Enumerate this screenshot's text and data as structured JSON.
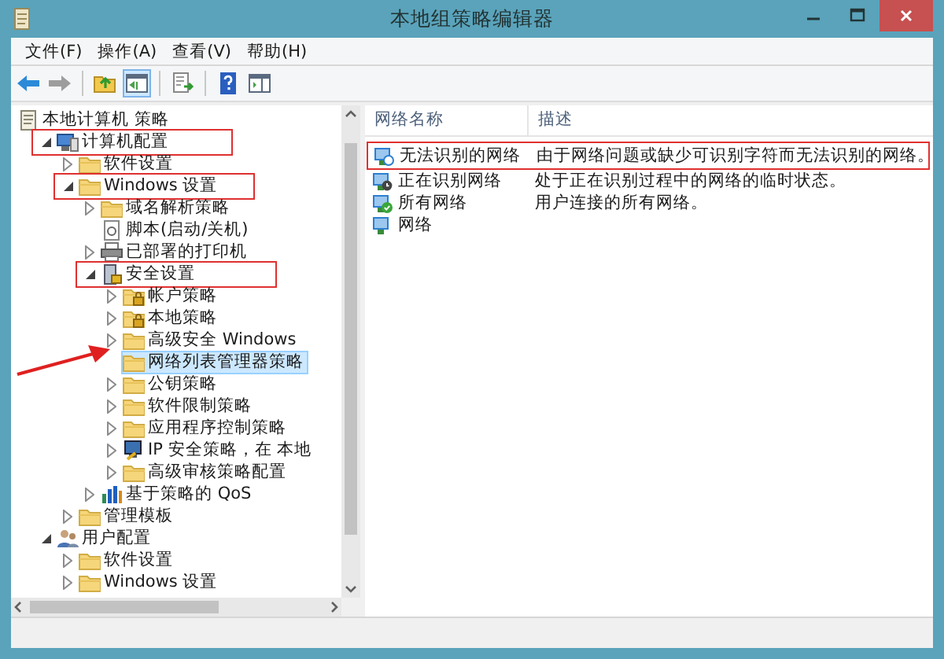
{
  "window": {
    "title": "本地组策略编辑器"
  },
  "menu": [
    "文件(F)",
    "操作(A)",
    "查看(V)",
    "帮助(H)"
  ],
  "toolbar": [
    [
      {
        "kind": "back",
        "pressed": false,
        "disabled": false
      },
      {
        "kind": "forward",
        "pressed": false,
        "disabled": true
      }
    ],
    [
      {
        "kind": "up",
        "pressed": false,
        "disabled": false
      },
      {
        "kind": "tree",
        "pressed": true,
        "disabled": false
      }
    ],
    [
      {
        "kind": "export",
        "pressed": false,
        "disabled": false
      }
    ],
    [
      {
        "kind": "help",
        "pressed": false,
        "disabled": false
      },
      {
        "kind": "pane",
        "pressed": false,
        "disabled": false
      }
    ]
  ],
  "tree": {
    "pointer_arrow": true,
    "items": [
      {
        "label": "本地计算机 策略",
        "kind": "policy",
        "selected": false,
        "annotated": false,
        "children": [
          {
            "label": "计算机配置",
            "kind": "computer",
            "expanded": true,
            "selected": false,
            "annotated": true,
            "children": [
              {
                "label": "软件设置",
                "kind": "folder",
                "expanded": false,
                "selected": false,
                "annotated": false
              },
              {
                "label": "Windows 设置",
                "kind": "folder",
                "expanded": true,
                "selected": false,
                "annotated": true,
                "children": [
                  {
                    "label": "域名解析策略",
                    "kind": "folder",
                    "expanded": false,
                    "selected": false,
                    "annotated": false
                  },
                  {
                    "label": "脚本(启动/关机)",
                    "kind": "script",
                    "selected": false,
                    "annotated": false
                  },
                  {
                    "label": "已部署的打印机",
                    "kind": "printer",
                    "expanded": false,
                    "selected": false,
                    "annotated": false
                  },
                  {
                    "label": "安全设置",
                    "kind": "security",
                    "expanded": true,
                    "selected": false,
                    "annotated": true,
                    "children": [
                      {
                        "label": "帐户策略",
                        "kind": "folder-lock",
                        "expanded": false,
                        "selected": false,
                        "annotated": false
                      },
                      {
                        "label": "本地策略",
                        "kind": "folder-lock",
                        "expanded": false,
                        "selected": false,
                        "annotated": false
                      },
                      {
                        "label": "高级安全 Windows",
                        "kind": "folder",
                        "expanded": false,
                        "selected": false,
                        "annotated": false
                      },
                      {
                        "label": "网络列表管理器策略",
                        "kind": "folder",
                        "selected": true,
                        "annotated": false
                      },
                      {
                        "label": "公钥策略",
                        "kind": "folder",
                        "expanded": false,
                        "selected": false,
                        "annotated": false
                      },
                      {
                        "label": "软件限制策略",
                        "kind": "folder",
                        "expanded": false,
                        "selected": false,
                        "annotated": false
                      },
                      {
                        "label": "应用程序控制策略",
                        "kind": "folder",
                        "expanded": false,
                        "selected": false,
                        "annotated": false
                      },
                      {
                        "label": "IP 安全策略，在 本地",
                        "kind": "ipsec",
                        "expanded": false,
                        "selected": false,
                        "annotated": false
                      },
                      {
                        "label": "高级审核策略配置",
                        "kind": "folder",
                        "expanded": false,
                        "selected": false,
                        "annotated": false
                      }
                    ]
                  },
                  {
                    "label": "基于策略的 QoS",
                    "kind": "qos",
                    "expanded": false,
                    "selected": false,
                    "annotated": false
                  }
                ]
              },
              {
                "label": "管理模板",
                "kind": "folder",
                "expanded": false,
                "selected": false,
                "annotated": false
              }
            ]
          },
          {
            "label": "用户配置",
            "kind": "user",
            "expanded": true,
            "selected": false,
            "annotated": false,
            "children": [
              {
                "label": "软件设置",
                "kind": "folder",
                "expanded": false,
                "selected": false,
                "annotated": false
              },
              {
                "label": "Windows 设置",
                "kind": "folder",
                "expanded": false,
                "selected": false,
                "annotated": false
              }
            ]
          }
        ]
      }
    ]
  },
  "list": {
    "columns": [
      "网络名称",
      "描述"
    ],
    "rows": [
      {
        "name": "无法识别的网络",
        "description": "由于网络问题或缺少可识别字符而无法识别的网络。",
        "kind": "unknown",
        "annotated": true
      },
      {
        "name": "正在识别网络",
        "description": "处于正在识别过程中的网络的临时状态。",
        "kind": "identifying",
        "annotated": false
      },
      {
        "name": "所有网络",
        "description": "用户连接的所有网络。",
        "kind": "all",
        "annotated": false
      },
      {
        "name": "网络",
        "kind": "network",
        "annotated": false
      }
    ]
  }
}
